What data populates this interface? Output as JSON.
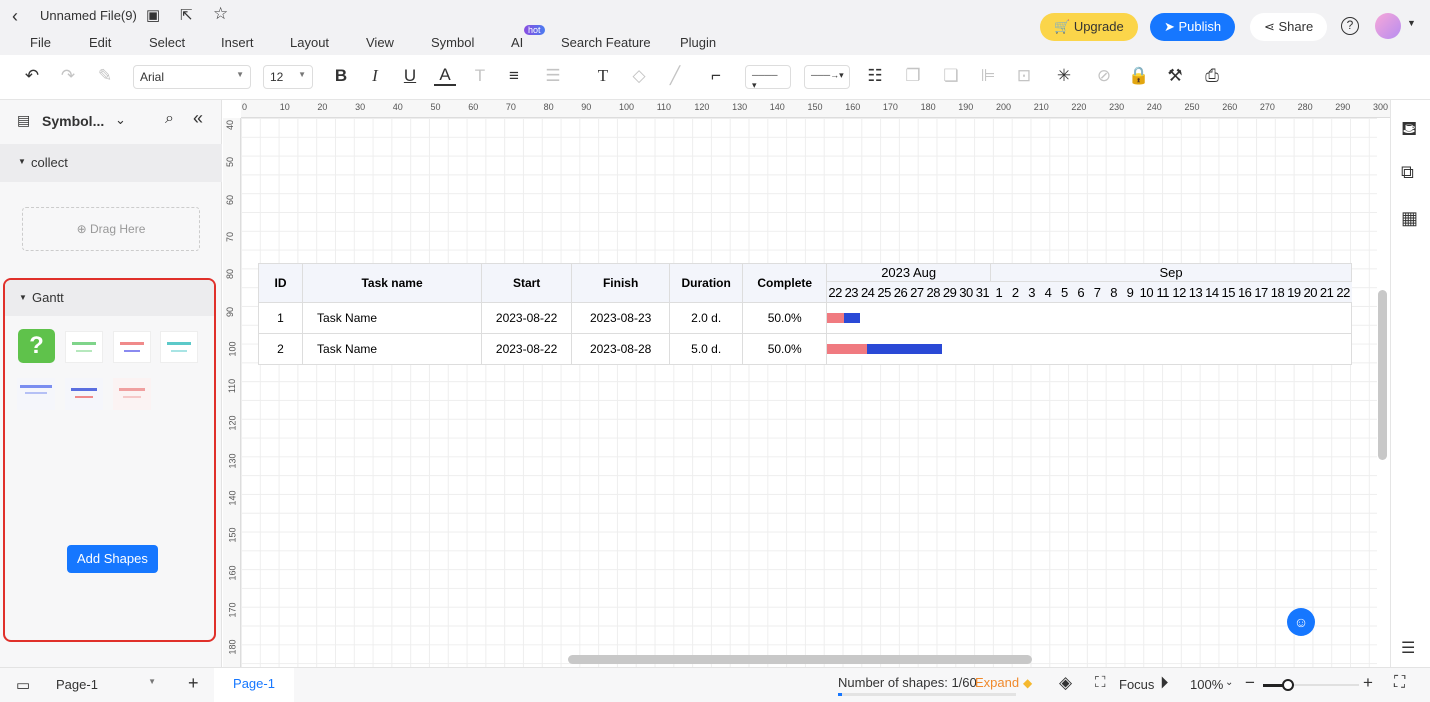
{
  "title": {
    "file_name": "Unnamed File(9)"
  },
  "menu": [
    "File",
    "Edit",
    "Select",
    "Insert",
    "Layout",
    "View",
    "Symbol",
    "AI",
    "Search Feature",
    "Plugin"
  ],
  "menu_badge": "hot",
  "header": {
    "upgrade": "Upgrade",
    "publish": "Publish",
    "share": "Share"
  },
  "toolbar": {
    "font": "Arial",
    "size": "12"
  },
  "sidebar": {
    "title": "Symbol...",
    "collect": "collect",
    "drag_here": "Drag Here",
    "gantt": "Gantt",
    "add_shapes": "Add Shapes"
  },
  "ruler": {
    "top": [
      0,
      10,
      20,
      30,
      40,
      50,
      60,
      70,
      80,
      90,
      100,
      110,
      120,
      130,
      140,
      150,
      160,
      170,
      180,
      190,
      200,
      210,
      220,
      230,
      240,
      250,
      260,
      270,
      280,
      290,
      300
    ],
    "left": [
      40,
      50,
      60,
      70,
      80,
      90,
      100,
      110,
      120,
      130,
      140,
      150,
      160,
      170,
      180
    ]
  },
  "gantt": {
    "columns": [
      "ID",
      "Task name",
      "Start",
      "Finish",
      "Duration",
      "Complete"
    ],
    "months": [
      "2023 Aug",
      "Sep"
    ],
    "days": [
      "22",
      "23",
      "24",
      "25",
      "26",
      "27",
      "28",
      "29",
      "30",
      "31",
      "1",
      "2",
      "3",
      "4",
      "5",
      "6",
      "7",
      "8",
      "9",
      "10",
      "11",
      "12",
      "13",
      "14",
      "15",
      "16",
      "17",
      "18",
      "19",
      "20",
      "21",
      "22"
    ],
    "rows": [
      {
        "id": "1",
        "name": "Task Name",
        "start": "2023-08-22",
        "finish": "2023-08-23",
        "duration": "2.0 d.",
        "complete": "50.0%",
        "start_day": 0,
        "days": 2,
        "progress": 0.5
      },
      {
        "id": "2",
        "name": "Task Name",
        "start": "2023-08-22",
        "finish": "2023-08-28",
        "duration": "5.0 d.",
        "complete": "50.0%",
        "start_day": 0,
        "days": 7,
        "progress": 0.35
      }
    ],
    "colors": {
      "done": "#f07a80",
      "remaining": "#2a49d6"
    }
  },
  "status": {
    "page_select": "Page-1",
    "page_tab": "Page-1",
    "shapes": "Number of shapes: 1/60",
    "expand": "Expand",
    "focus": "Focus",
    "zoom": "100%"
  }
}
